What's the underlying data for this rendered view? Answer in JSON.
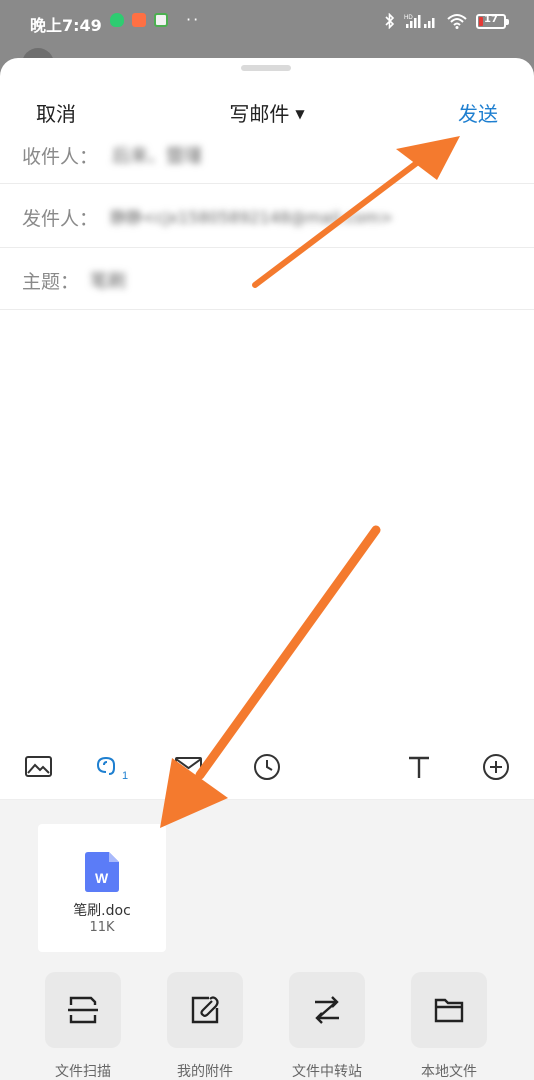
{
  "status_bar": {
    "time": "晚上7:49",
    "battery": "17",
    "battery_level": 0.17,
    "more": "··",
    "network_label": "HD"
  },
  "nav": {
    "cancel": "取消",
    "title": "写邮件",
    "send": "发送"
  },
  "fields": {
    "to": {
      "label": "收件人：",
      "value": "后来、暨瑾"
    },
    "from": {
      "label": "发件人：",
      "value": "静静<cjx15805892148@mail.com>"
    },
    "subject": {
      "label": "主题：",
      "value": "笔刷"
    }
  },
  "toolbar": {
    "items": [
      "image-icon",
      "attachment-icon",
      "mail-icon",
      "clock-icon",
      "text-format-icon",
      "add-circle-icon"
    ],
    "attachment_count": "1"
  },
  "attachment": {
    "name": "笔刷.doc",
    "size": "11K",
    "icon_letter": "W",
    "icon_color": "#5b7cf7"
  },
  "sources": [
    {
      "label": "文件扫描",
      "icon": "scan-icon"
    },
    {
      "label": "我的附件",
      "icon": "my-attachment-icon"
    },
    {
      "label": "文件中转站",
      "icon": "transfer-icon"
    },
    {
      "label": "本地文件",
      "icon": "folder-icon"
    }
  ],
  "colors": {
    "accent": "#1e7fd0",
    "annotation_arrow": "#f47a2e"
  }
}
